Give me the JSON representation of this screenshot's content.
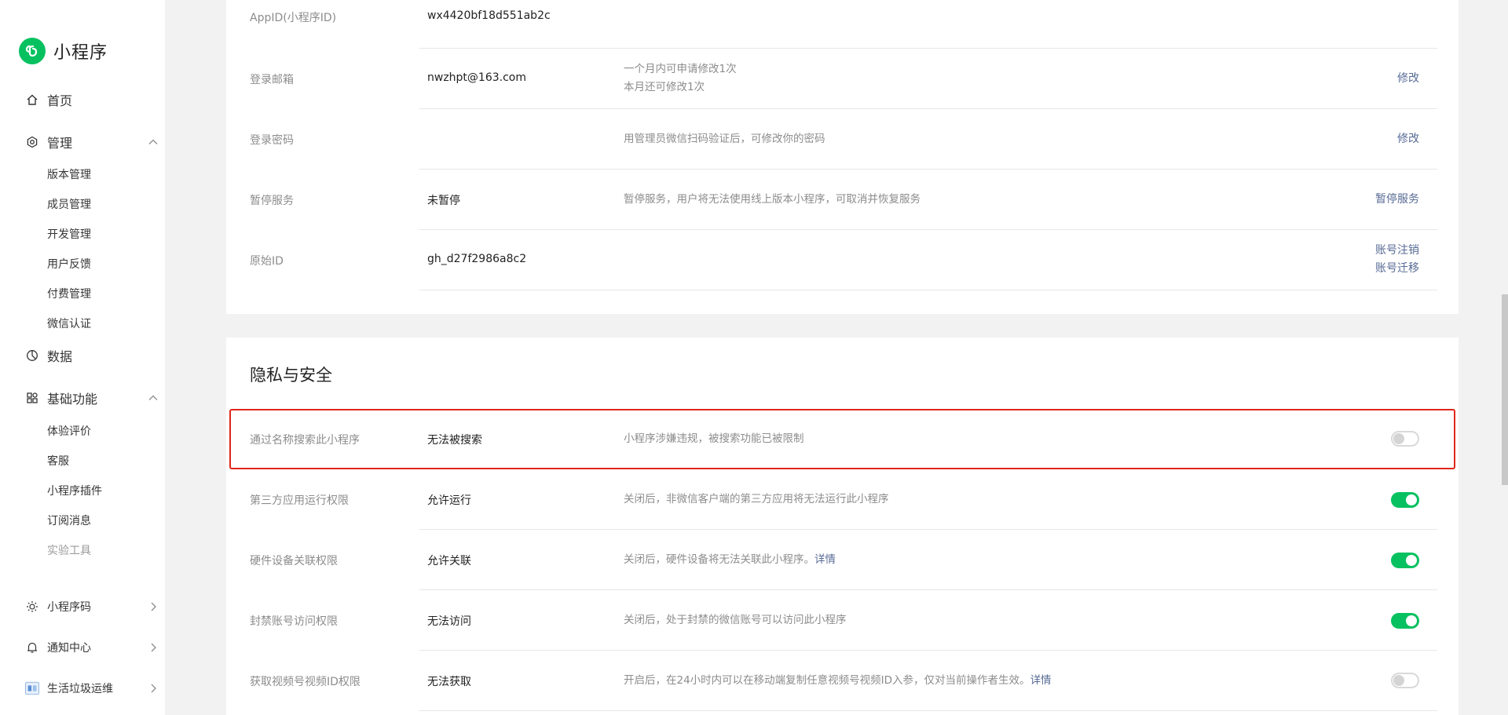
{
  "brand": {
    "title": "小程序",
    "accent": "#07c160"
  },
  "sidebar": {
    "home": "首页",
    "manage": {
      "label": "管理",
      "items": [
        "版本管理",
        "成员管理",
        "开发管理",
        "用户反馈",
        "付费管理",
        "微信认证"
      ]
    },
    "data": "数据",
    "basic": {
      "label": "基础功能",
      "items": [
        "体验评价",
        "客服",
        "小程序插件",
        "订阅消息",
        "实验工具"
      ]
    },
    "bottom": [
      "小程序码",
      "通知中心",
      "生活垃圾运维"
    ]
  },
  "account": {
    "rows": [
      {
        "label": "AppID(小程序ID)",
        "value": "wx4420bf18d551ab2c",
        "desc": [],
        "actions": []
      },
      {
        "label": "登录邮箱",
        "value": "nwzhpt@163.com",
        "desc": [
          "一个月内可申请修改1次",
          "本月还可修改1次"
        ],
        "actions": [
          "修改"
        ]
      },
      {
        "label": "登录密码",
        "value": "",
        "desc": [
          "用管理员微信扫码验证后，可修改你的密码"
        ],
        "actions": [
          "修改"
        ]
      },
      {
        "label": "暂停服务",
        "value": "未暂停",
        "desc": [
          "暂停服务，用户将无法使用线上版本小程序，可取消并恢复服务"
        ],
        "actions": [
          "暂停服务"
        ]
      },
      {
        "label": "原始ID",
        "value": "gh_d27f2986a8c2",
        "desc": [],
        "actions": [
          "账号注销",
          "账号迁移"
        ]
      }
    ]
  },
  "privacy": {
    "title": "隐私与安全",
    "rows": [
      {
        "label": "通过名称搜索此小程序",
        "value": "无法被搜索",
        "desc": "小程序涉嫌违规，被搜索功能已被限制",
        "link": "",
        "toggle": false,
        "highlighted": true
      },
      {
        "label": "第三方应用运行权限",
        "value": "允许运行",
        "desc": "关闭后，非微信客户端的第三方应用将无法运行此小程序",
        "link": "",
        "toggle": true,
        "highlighted": false
      },
      {
        "label": "硬件设备关联权限",
        "value": "允许关联",
        "desc": "关闭后，硬件设备将无法关联此小程序。",
        "link": "详情",
        "toggle": true,
        "highlighted": false
      },
      {
        "label": "封禁账号访问权限",
        "value": "无法访问",
        "desc": "关闭后，处于封禁的微信账号可以访问此小程序",
        "link": "",
        "toggle": true,
        "highlighted": false
      },
      {
        "label": "获取视频号视频ID权限",
        "value": "无法获取",
        "desc": "开启后，在24小时内可以在移动端复制任意视频号视频ID入参，仅对当前操作者生效。",
        "link": "详情",
        "toggle": false,
        "highlighted": false
      }
    ]
  },
  "colors": {
    "link": "#576b95",
    "toggle_on": "#07c160",
    "highlight": "#e0261a"
  }
}
